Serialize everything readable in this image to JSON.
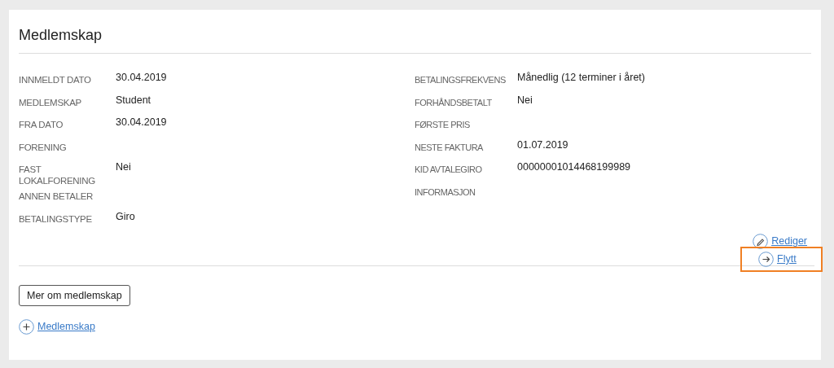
{
  "card": {
    "title": "Medlemskap"
  },
  "left_fields": [
    {
      "label": "INNMELDT DATO",
      "value": "30.04.2019"
    },
    {
      "label": "MEDLEMSKAP",
      "value": "Student"
    },
    {
      "label": "FRA DATO",
      "value": "30.04.2019"
    },
    {
      "label": "FORENING"
    },
    {
      "label": "FAST LOKALFORENING",
      "value": "Nei"
    },
    {
      "label": "ANNEN BETALER"
    },
    {
      "label": "BETALINGSTYPE",
      "value": "Giro"
    }
  ],
  "right_fields": [
    {
      "label": "BETALINGSFREKVENS",
      "value": "Månedlig (12 terminer i året)"
    },
    {
      "label": "FORHÅNDSBETALT",
      "value": "Nei"
    },
    {
      "label": "FØRSTE PRIS"
    },
    {
      "label": "NESTE FAKTURA",
      "value": "01.07.2019"
    },
    {
      "label": "KID AVTALEGIRO",
      "value": "00000001014468199989"
    },
    {
      "label": "INFORMASJON"
    }
  ],
  "actions": [
    {
      "kind": "edit",
      "label": "Rediger",
      "highlighted": false
    },
    {
      "kind": "move",
      "label": "Flytt",
      "highlighted": true
    }
  ],
  "more_button": "Mer om medlemskap",
  "add_link": {
    "kind": "add",
    "label": "Medlemskap"
  }
}
